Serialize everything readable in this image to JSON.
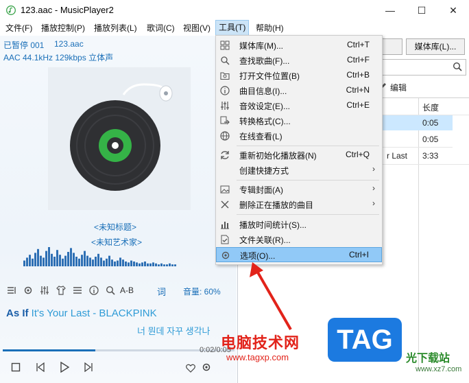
{
  "window": {
    "title": "123.aac - MusicPlayer2",
    "controls": {
      "minimize": "—",
      "maximize": "☐",
      "close": "✕"
    }
  },
  "menubar": [
    {
      "label": "文件(F)"
    },
    {
      "label": "播放控制(P)"
    },
    {
      "label": "播放列表(L)"
    },
    {
      "label": "歌词(C)"
    },
    {
      "label": "视图(V)"
    },
    {
      "label": "工具(T)",
      "active": true
    },
    {
      "label": "帮助(H)"
    }
  ],
  "player": {
    "status": "已暂停 001",
    "filename": "123.aac",
    "format": "AAC 44.1kHz 129kbps 立体声",
    "title": "<未知标题>",
    "artist": "<未知艺术家>",
    "volume": "音量: 60%",
    "ab_label": "A-B",
    "lyric_button": "词",
    "lyric_line1_bold": "As If",
    "lyric_line1_rest": " It's Your Last - BLACKPINK",
    "lyric_line2": "너 뭔데 자꾸 생각나",
    "time": "0:02/0:05",
    "progress_fraction": 0.4
  },
  "playlist_panel": {
    "media_library_button": "媒体库(L)...",
    "edit_button": "编辑",
    "column_length": "长度",
    "rows": [
      {
        "name": "",
        "length": "0:05",
        "selected": true
      },
      {
        "name": "",
        "length": "0:05",
        "selected": false
      },
      {
        "name": "r Last",
        "length": "3:33",
        "selected": false
      }
    ]
  },
  "tools_menu": {
    "items": [
      {
        "label": "媒体库(M)...",
        "shortcut": "Ctrl+T",
        "icon": "grid-icon"
      },
      {
        "label": "查找歌曲(F)...",
        "shortcut": "Ctrl+F",
        "icon": "search-icon"
      },
      {
        "label": "打开文件位置(B)",
        "shortcut": "Ctrl+B",
        "icon": "folder-search-icon"
      },
      {
        "label": "曲目信息(I)...",
        "shortcut": "Ctrl+N",
        "icon": "info-icon"
      },
      {
        "label": "音效设定(E)...",
        "shortcut": "Ctrl+E",
        "icon": "equalizer-icon"
      },
      {
        "label": "转换格式(C)...",
        "shortcut": "",
        "icon": "convert-icon"
      },
      {
        "label": "在线查看(L)",
        "shortcut": "",
        "icon": "globe-icon"
      },
      {
        "label": "重新初始化播放器(N)",
        "shortcut": "Ctrl+Q",
        "icon": "refresh-icon"
      },
      {
        "label": "创建快捷方式",
        "shortcut": "",
        "icon": "",
        "submenu": true
      },
      {
        "label": "专辑封面(A)",
        "shortcut": "",
        "icon": "image-icon",
        "submenu": true
      },
      {
        "label": "删除正在播放的曲目",
        "shortcut": "",
        "icon": "close-icon",
        "submenu": true
      },
      {
        "label": "播放时间统计(S)...",
        "shortcut": "",
        "icon": "bar-chart-icon"
      },
      {
        "label": "文件关联(R)...",
        "shortcut": "",
        "icon": "file-check-icon"
      },
      {
        "label": "选项(O)...",
        "shortcut": "Ctrl+I",
        "icon": "gear-icon",
        "highlighted": true
      }
    ]
  },
  "watermark": {
    "text": "电脑技术网",
    "url": "www.tagxp.com",
    "tag": "TAG",
    "site": "光下载站",
    "site_url": "www.xz7.com"
  }
}
